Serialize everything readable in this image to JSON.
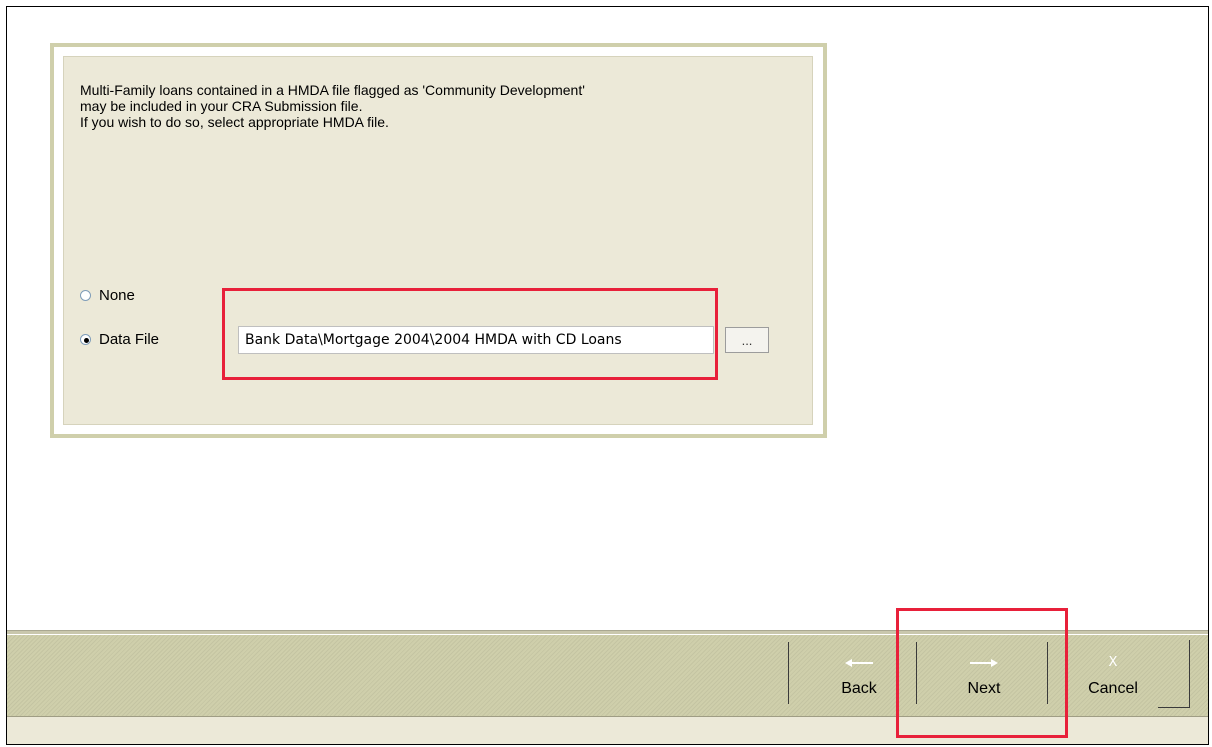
{
  "info": {
    "lines": [
      "Multi-Family loans contained in a HMDA file flagged as 'Community Development'",
      "may be included in your CRA Submission file.",
      "If you wish to do so, select appropriate HMDA file."
    ]
  },
  "options": {
    "none_label": "None",
    "datafile_label": "Data File",
    "selected": "Data File"
  },
  "file_path": {
    "value": "Bank Data\\Mortgage 2004\\2004 HMDA with CD Loans"
  },
  "browse_label": "...",
  "footer": {
    "back_label": "Back",
    "next_label": "Next",
    "cancel_label": "Cancel",
    "cancel_icon_text": "X"
  },
  "colors": {
    "highlight": "#e8203a",
    "panel_border": "#cfcfab",
    "panel_bg": "#ece9d8"
  },
  "icons": {
    "back": "arrow-left-icon",
    "next": "arrow-right-icon",
    "cancel": "close-icon"
  }
}
